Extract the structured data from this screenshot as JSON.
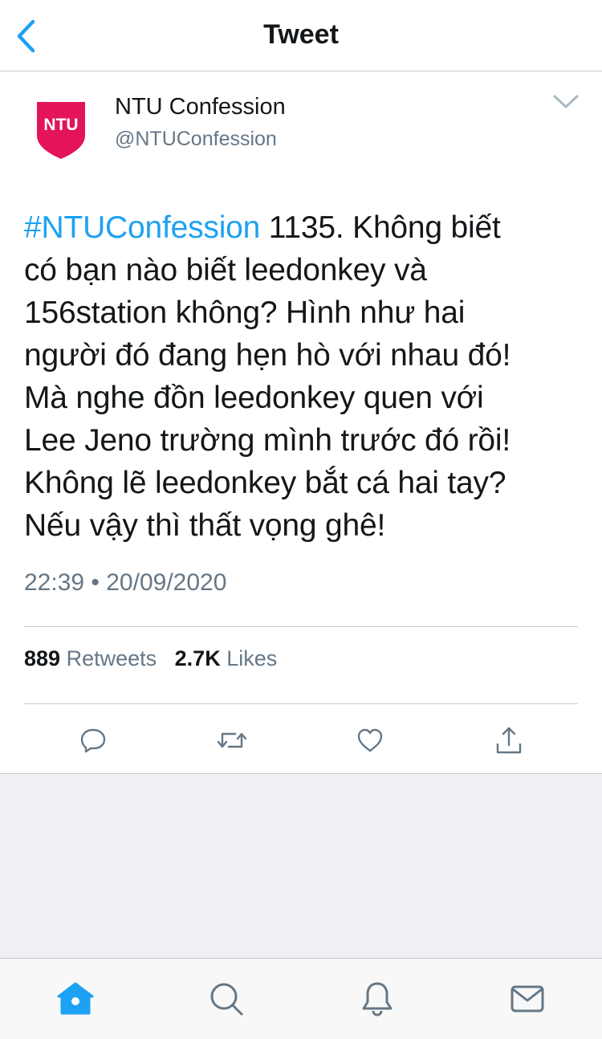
{
  "header": {
    "title": "Tweet"
  },
  "author": {
    "name": "NTU Confession",
    "handle": "@NTUConfession",
    "avatar_text": "NTU",
    "avatar_color": "#e3145a"
  },
  "tweet": {
    "hashtag": "#NTUConfession",
    "lines": [
      " 1135. Không biết",
      "có bạn nào biết leedonkey và",
      "156station không? Hình như hai",
      "người đó đang hẹn hò với nhau đó!",
      "Mà nghe đồn leedonkey quen với",
      "Lee Jeno trường mình trước đó rồi!",
      "Không lẽ leedonkey bắt cá hai tay?",
      "Nếu vậy thì thất vọng ghê!"
    ],
    "timestamp": "22:39 • 20/09/2020"
  },
  "stats": {
    "retweets_count": "889",
    "retweets_label": "Retweets",
    "likes_count": "2.7K",
    "likes_label": "Likes"
  },
  "actions": [
    "reply-icon",
    "retweet-icon",
    "like-icon",
    "share-icon"
  ],
  "tabs": [
    "home-icon",
    "search-icon",
    "notifications-icon",
    "messages-icon"
  ],
  "colors": {
    "accent": "#1da1f2",
    "text": "#14171a",
    "secondary": "#657786",
    "divider": "#c8c8cc",
    "background_gray": "#efeff4"
  }
}
